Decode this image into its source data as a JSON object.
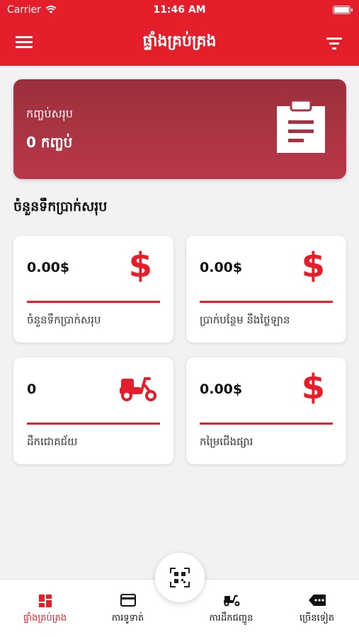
{
  "status_bar": {
    "carrier": "Carrier",
    "time": "11:46 AM"
  },
  "header": {
    "title": "ផ្ទាំងគ្រប់គ្រង",
    "menu_icon": "hamburger-icon",
    "filter_icon": "filter-icon"
  },
  "summary_card": {
    "label": "កញ្ចប់សរុប",
    "value": "0 កញ្ចប់",
    "icon": "clipboard-icon"
  },
  "section": {
    "title": "ចំនួនទឹកប្រាក់សរុប"
  },
  "stats": [
    {
      "value": "0.00$",
      "label": "ចំនួនទឹកប្រាក់សរុប",
      "icon": "dollar-icon"
    },
    {
      "value": "0.00$",
      "label": "ប្រាក់បន្ថែម នឹងថ្លៃឡាន",
      "icon": "dollar-icon"
    },
    {
      "value": "0",
      "label": "ដឹកជោគជ័យ",
      "icon": "delivery-scooter-icon"
    },
    {
      "value": "0.00$",
      "label": "កម្រៃជើងផ្សារ",
      "icon": "dollar-icon"
    }
  ],
  "tabs": [
    {
      "label": "ផ្ទាំងគ្រប់គ្រង",
      "icon": "dashboard-icon",
      "active": true
    },
    {
      "label": "ការទូទាត់",
      "icon": "payment-card-icon",
      "active": false
    },
    {
      "label": "ការដឹកជញ្ជូន",
      "icon": "delivery-scooter-icon",
      "active": false
    },
    {
      "label": "ច្រើនទៀត",
      "icon": "more-tag-icon",
      "active": false
    }
  ],
  "scan_button": {
    "icon": "qr-scan-icon"
  },
  "colors": {
    "primary": "#e41e2b",
    "summary_card": "#a8323f",
    "background": "#f2f2f4"
  }
}
